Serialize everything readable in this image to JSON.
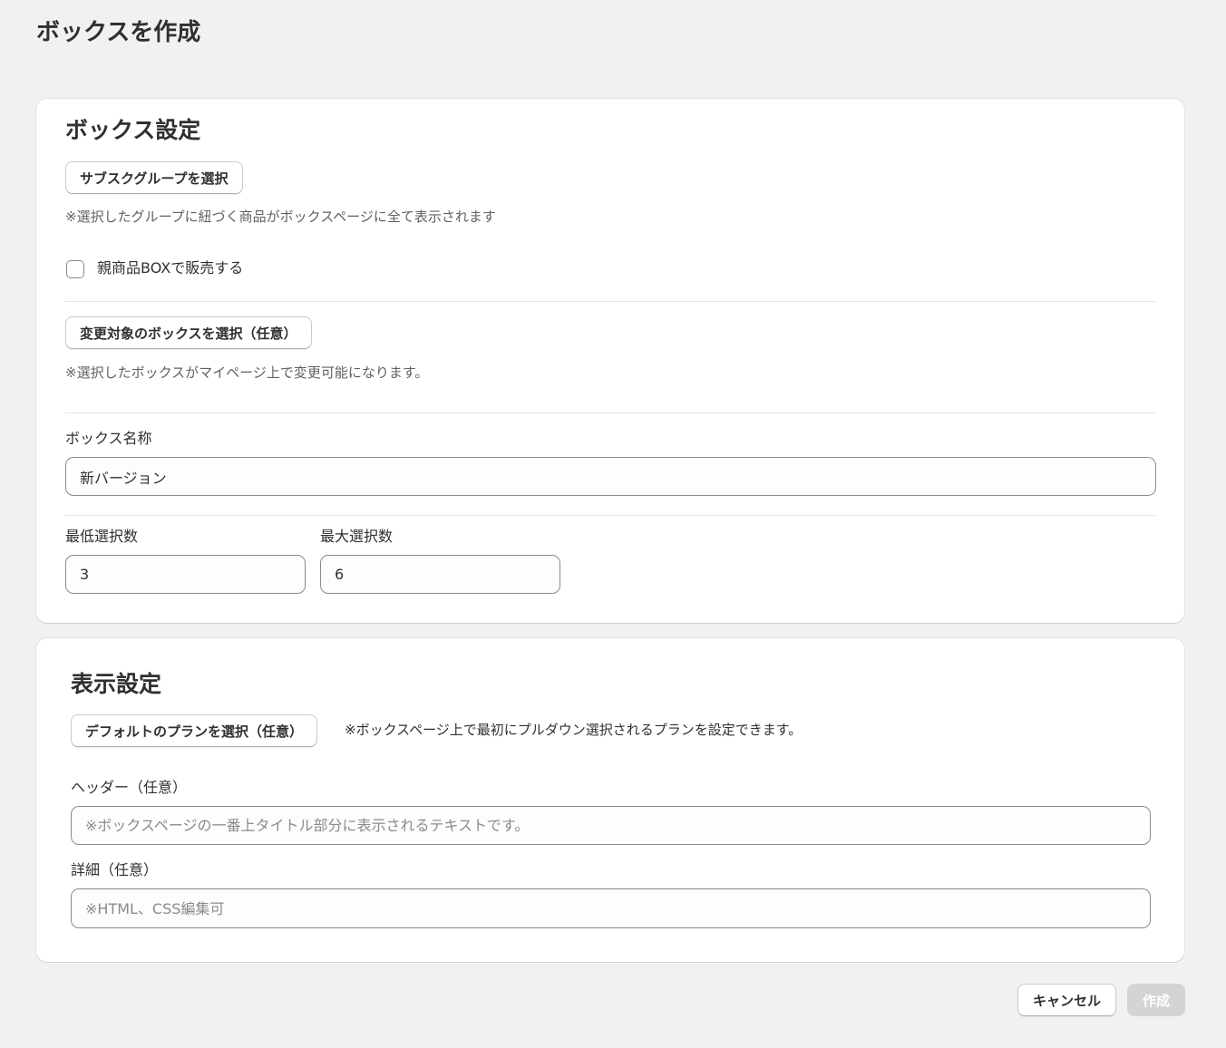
{
  "page": {
    "title": "ボックスを作成"
  },
  "box_settings": {
    "title": "ボックス設定",
    "select_group_button": "サブスクグループを選択",
    "group_note": "※選択したグループに紐づく商品がボックスページに全て表示されます",
    "parent_box_checkbox": {
      "label": "親商品BOXで販売する",
      "checked": false
    },
    "select_target_box_button": "変更対象のボックスを選択（任意）",
    "target_box_note": "※選択したボックスがマイページ上で変更可能になります。",
    "box_name": {
      "label": "ボックス名称",
      "value": "新バージョン"
    },
    "min_select": {
      "label": "最低選択数",
      "value": "3"
    },
    "max_select": {
      "label": "最大選択数",
      "value": "6"
    }
  },
  "display_settings": {
    "title": "表示設定",
    "default_plan_button": "デフォルトのプランを選択（任意）",
    "default_plan_note": "※ボックスページ上で最初にプルダウン選択されるプランを設定できます。",
    "header": {
      "label": "ヘッダー（任意）",
      "placeholder": "※ボックスページの一番上タイトル部分に表示されるテキストです。",
      "value": ""
    },
    "detail": {
      "label": "詳細（任意）",
      "placeholder": "※HTML、CSS編集可",
      "value": ""
    }
  },
  "footer": {
    "cancel_label": "キャンセル",
    "create_label": "作成"
  }
}
